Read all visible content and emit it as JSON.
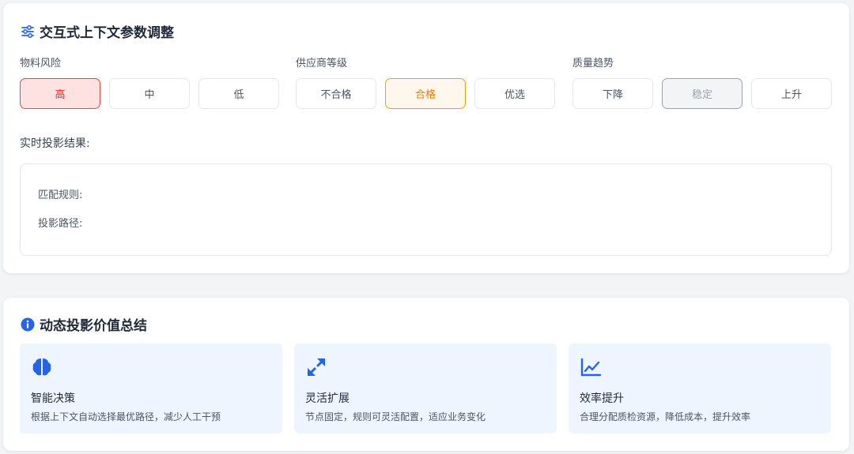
{
  "params": {
    "title": "交互式上下文参数调整",
    "title_icon": "sliders-icon",
    "groups": [
      {
        "label": "物料风险",
        "options": [
          "高",
          "中",
          "低"
        ],
        "selected": "高",
        "selected_color": "#ef4444"
      },
      {
        "label": "供应商等级",
        "options": [
          "不合格",
          "合格",
          "优选"
        ],
        "selected": "合格",
        "selected_color": "#f59e0b"
      },
      {
        "label": "质量趋势",
        "options": [
          "下降",
          "稳定",
          "上升"
        ],
        "selected": "稳定",
        "selected_color": "#9ca3af"
      }
    ],
    "result_label": "实时投影结果:",
    "result_lines": [
      "匹配规则:",
      "投影路径:"
    ]
  },
  "summary": {
    "title": "动态投影价值总结",
    "title_icon": "info-circle-icon",
    "features": [
      {
        "icon": "brain-icon",
        "title": "智能决策",
        "desc": "根据上下文自动选择最优路径，减少人工干预"
      },
      {
        "icon": "expand-arrows-icon",
        "title": "灵活扩展",
        "desc": "节点固定，规则可灵活配置，适应业务变化"
      },
      {
        "icon": "line-chart-icon",
        "title": "效率提升",
        "desc": "合理分配质检资源，降低成本，提升效率"
      }
    ]
  },
  "colors": {
    "accent": "#2563eb",
    "feature_bg": "#eef5ff"
  }
}
